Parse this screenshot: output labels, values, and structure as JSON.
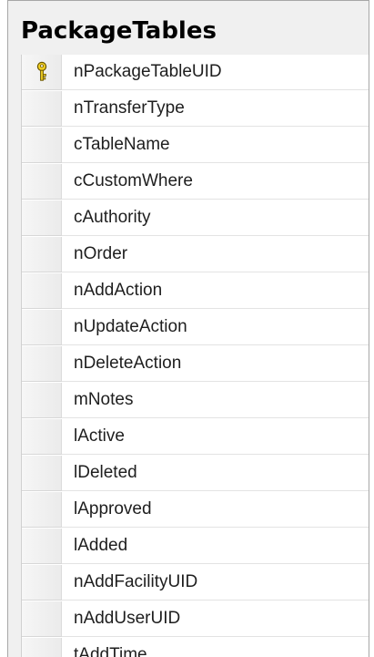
{
  "table": {
    "title": "PackageTables",
    "columns": [
      {
        "name": "nPackageTableUID",
        "primary_key": true,
        "icon": "primary-key-icon"
      },
      {
        "name": "nTransferType",
        "primary_key": false
      },
      {
        "name": "cTableName",
        "primary_key": false
      },
      {
        "name": "cCustomWhere",
        "primary_key": false
      },
      {
        "name": "cAuthority",
        "primary_key": false
      },
      {
        "name": "nOrder",
        "primary_key": false
      },
      {
        "name": "nAddAction",
        "primary_key": false
      },
      {
        "name": "nUpdateAction",
        "primary_key": false
      },
      {
        "name": "nDeleteAction",
        "primary_key": false
      },
      {
        "name": "mNotes",
        "primary_key": false
      },
      {
        "name": "lActive",
        "primary_key": false
      },
      {
        "name": "lDeleted",
        "primary_key": false
      },
      {
        "name": "lApproved",
        "primary_key": false
      },
      {
        "name": "lAdded",
        "primary_key": false
      },
      {
        "name": "nAddFacilityUID",
        "primary_key": false
      },
      {
        "name": "nAddUserUID",
        "primary_key": false
      },
      {
        "name": "tAddTime",
        "primary_key": false
      }
    ]
  },
  "colors": {
    "key_icon": "#d9b000",
    "frame_border": "#a7a7a7",
    "title_band": "#f0f0f0"
  }
}
